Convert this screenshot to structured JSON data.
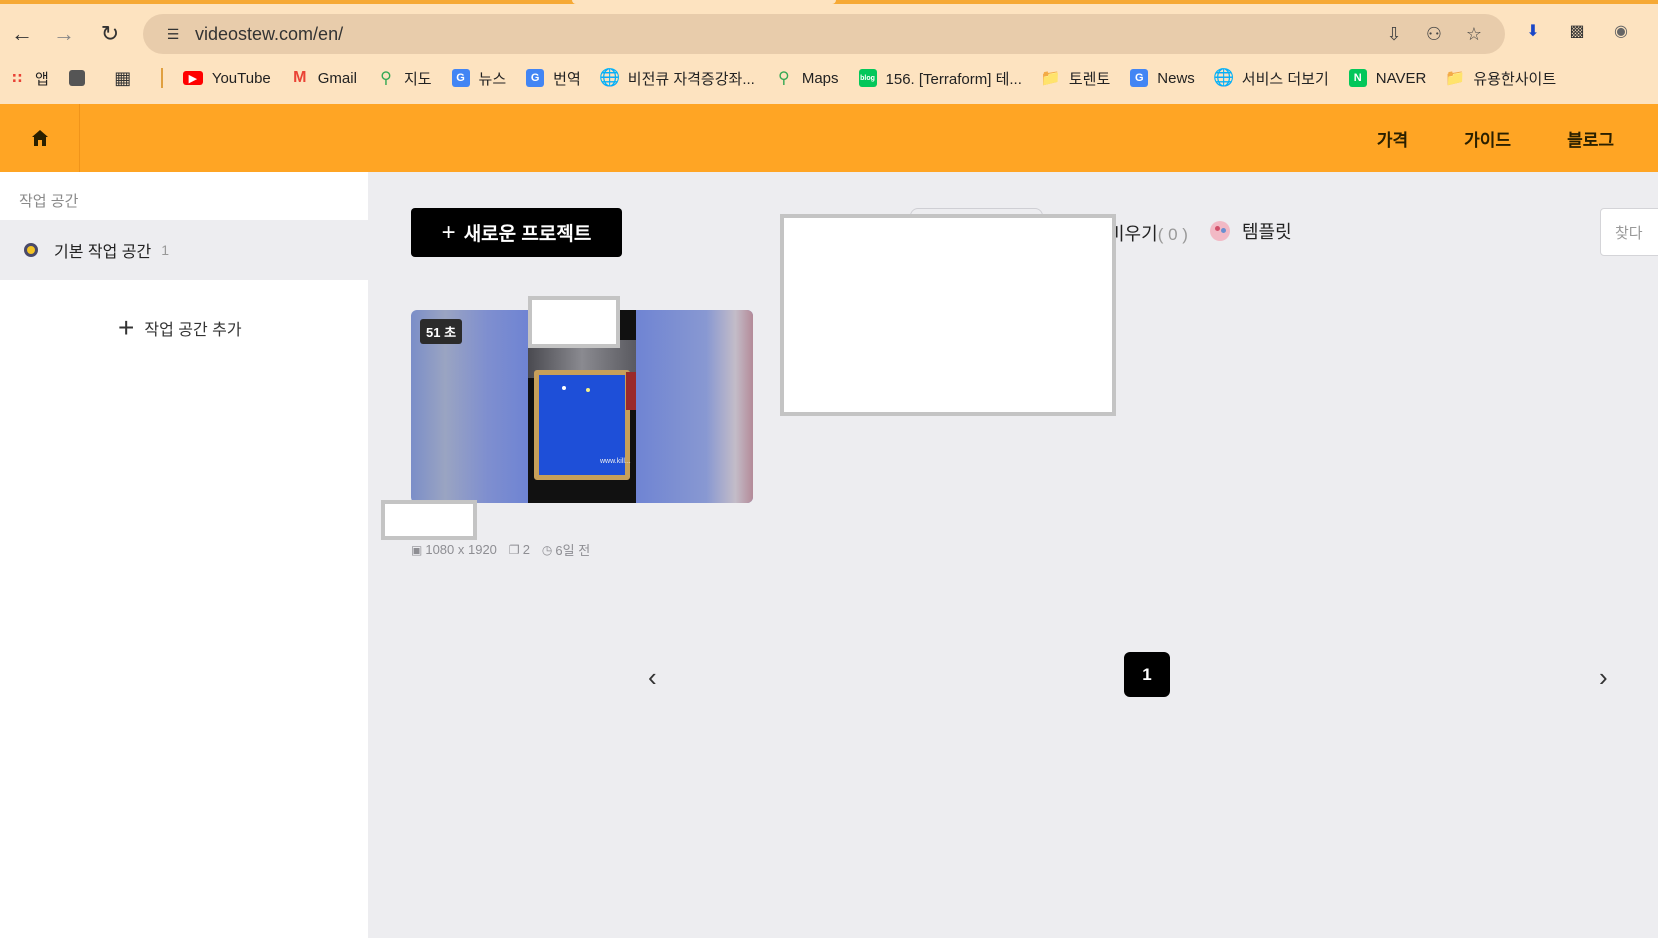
{
  "browser": {
    "url": "videostew.com/en/",
    "bookmarks": [
      {
        "label": "앱",
        "icon": "apps-grid-icon",
        "color": "#e94235"
      },
      {
        "label": "",
        "icon": "extension-square-icon",
        "color": "#555555"
      },
      {
        "label": "",
        "icon": "grid-four-icon",
        "color": "#333333"
      },
      {
        "label": "YouTube",
        "icon": "youtube-icon",
        "color": "#ff0000"
      },
      {
        "label": "Gmail",
        "icon": "gmail-icon",
        "color": "#ea4335"
      },
      {
        "label": "지도",
        "icon": "maps-pin-icon",
        "color": "#34a853"
      },
      {
        "label": "뉴스",
        "icon": "google-news-icon",
        "color": "#4285f4"
      },
      {
        "label": "번역",
        "icon": "translate-icon",
        "color": "#4285f4"
      },
      {
        "label": "비전큐 자격증강좌...",
        "icon": "globe-icon",
        "color": "#222222"
      },
      {
        "label": "Maps",
        "icon": "maps-pin-icon",
        "color": "#34a853"
      },
      {
        "label": "156. [Terraform] 테...",
        "icon": "blog-icon",
        "color": "#03c75a"
      },
      {
        "label": "토렌토",
        "icon": "folder-icon",
        "color": "#555555"
      },
      {
        "label": "News",
        "icon": "google-news-icon",
        "color": "#4285f4"
      },
      {
        "label": "서비스 더보기",
        "icon": "globe-icon",
        "color": "#222222"
      },
      {
        "label": "NAVER",
        "icon": "naver-icon",
        "color": "#03c75a"
      },
      {
        "label": "유용한사이트",
        "icon": "folder-icon",
        "color": "#555555"
      }
    ]
  },
  "header": {
    "nav": [
      "가격",
      "가이드",
      "블로그"
    ],
    "accent": "#ffa524"
  },
  "sidebar": {
    "title": "작업 공간",
    "workspace": {
      "label": "기본 작업 공간",
      "count": "1"
    },
    "add_label": "작업 공간 추가"
  },
  "main": {
    "new_project_label": "새로운 프로젝트",
    "trash_label": "휴지통 비우기",
    "trash_visible_label": "비우기",
    "trash_count": "( 0 )",
    "template_label": "템플릿",
    "search_placeholder": "찾다",
    "project": {
      "duration": "51 초",
      "resolution": "1080 x 1920",
      "scenes": "2",
      "age": "6일 전",
      "watermark": "www.kill..."
    },
    "pagination": {
      "current": "1"
    }
  }
}
